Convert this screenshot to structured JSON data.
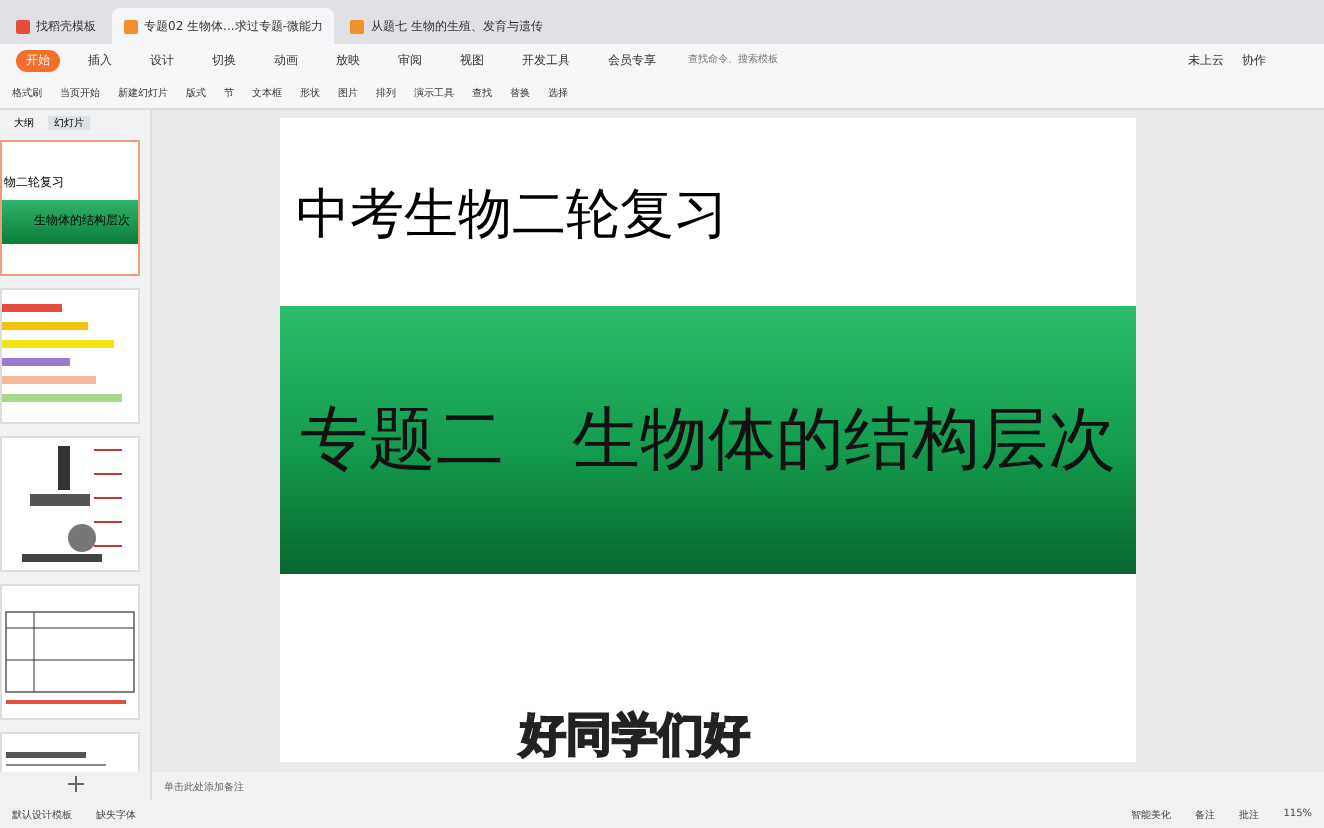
{
  "doc_tabs": [
    {
      "label": "找稻壳模板",
      "selected": false,
      "kind": "home"
    },
    {
      "label": "专题02 生物体...求过专题-微能力",
      "selected": true,
      "kind": "ppt"
    },
    {
      "label": "从题七 生物的生殖、发育与遗传",
      "selected": false,
      "kind": "ppt"
    }
  ],
  "menu": [
    {
      "label": "开始",
      "selected": true
    },
    {
      "label": "插入",
      "selected": false
    },
    {
      "label": "设计",
      "selected": false
    },
    {
      "label": "切换",
      "selected": false
    },
    {
      "label": "动画",
      "selected": false
    },
    {
      "label": "放映",
      "selected": false
    },
    {
      "label": "审阅",
      "selected": false
    },
    {
      "label": "视图",
      "selected": false
    },
    {
      "label": "开发工具",
      "selected": false
    },
    {
      "label": "会员专享",
      "selected": false
    }
  ],
  "search": {
    "placeholder": "查找命令、搜索模板"
  },
  "account": [
    "未上云",
    "协作"
  ],
  "ribbon": [
    "格式刷",
    "当页开始",
    "新建幻灯片",
    "版式",
    "节",
    "文本框",
    "形状",
    "图片",
    "排列",
    "演示工具",
    "查找",
    "替换",
    "选择"
  ],
  "panel_tabs": [
    {
      "label": "大纲",
      "selected": false
    },
    {
      "label": "幻灯片",
      "selected": true
    }
  ],
  "thumbnails": [
    {
      "kind": "title",
      "selected": true,
      "title": "物二轮复习",
      "banner": "生物体的结构层次"
    },
    {
      "kind": "list",
      "selected": false
    },
    {
      "kind": "diagram",
      "selected": false
    },
    {
      "kind": "table",
      "selected": false
    },
    {
      "kind": "text",
      "selected": false
    }
  ],
  "slide": {
    "title": "中考生物二轮复习",
    "banner": "专题二　生物体的结构层次"
  },
  "caption": "好同学们好",
  "notes": {
    "placeholder": "单击此处添加备注"
  },
  "status_left": [
    "默认设计模板",
    "缺失字体"
  ],
  "status_right": [
    "智能美化",
    "备注",
    "批注"
  ],
  "zoom": "115%"
}
